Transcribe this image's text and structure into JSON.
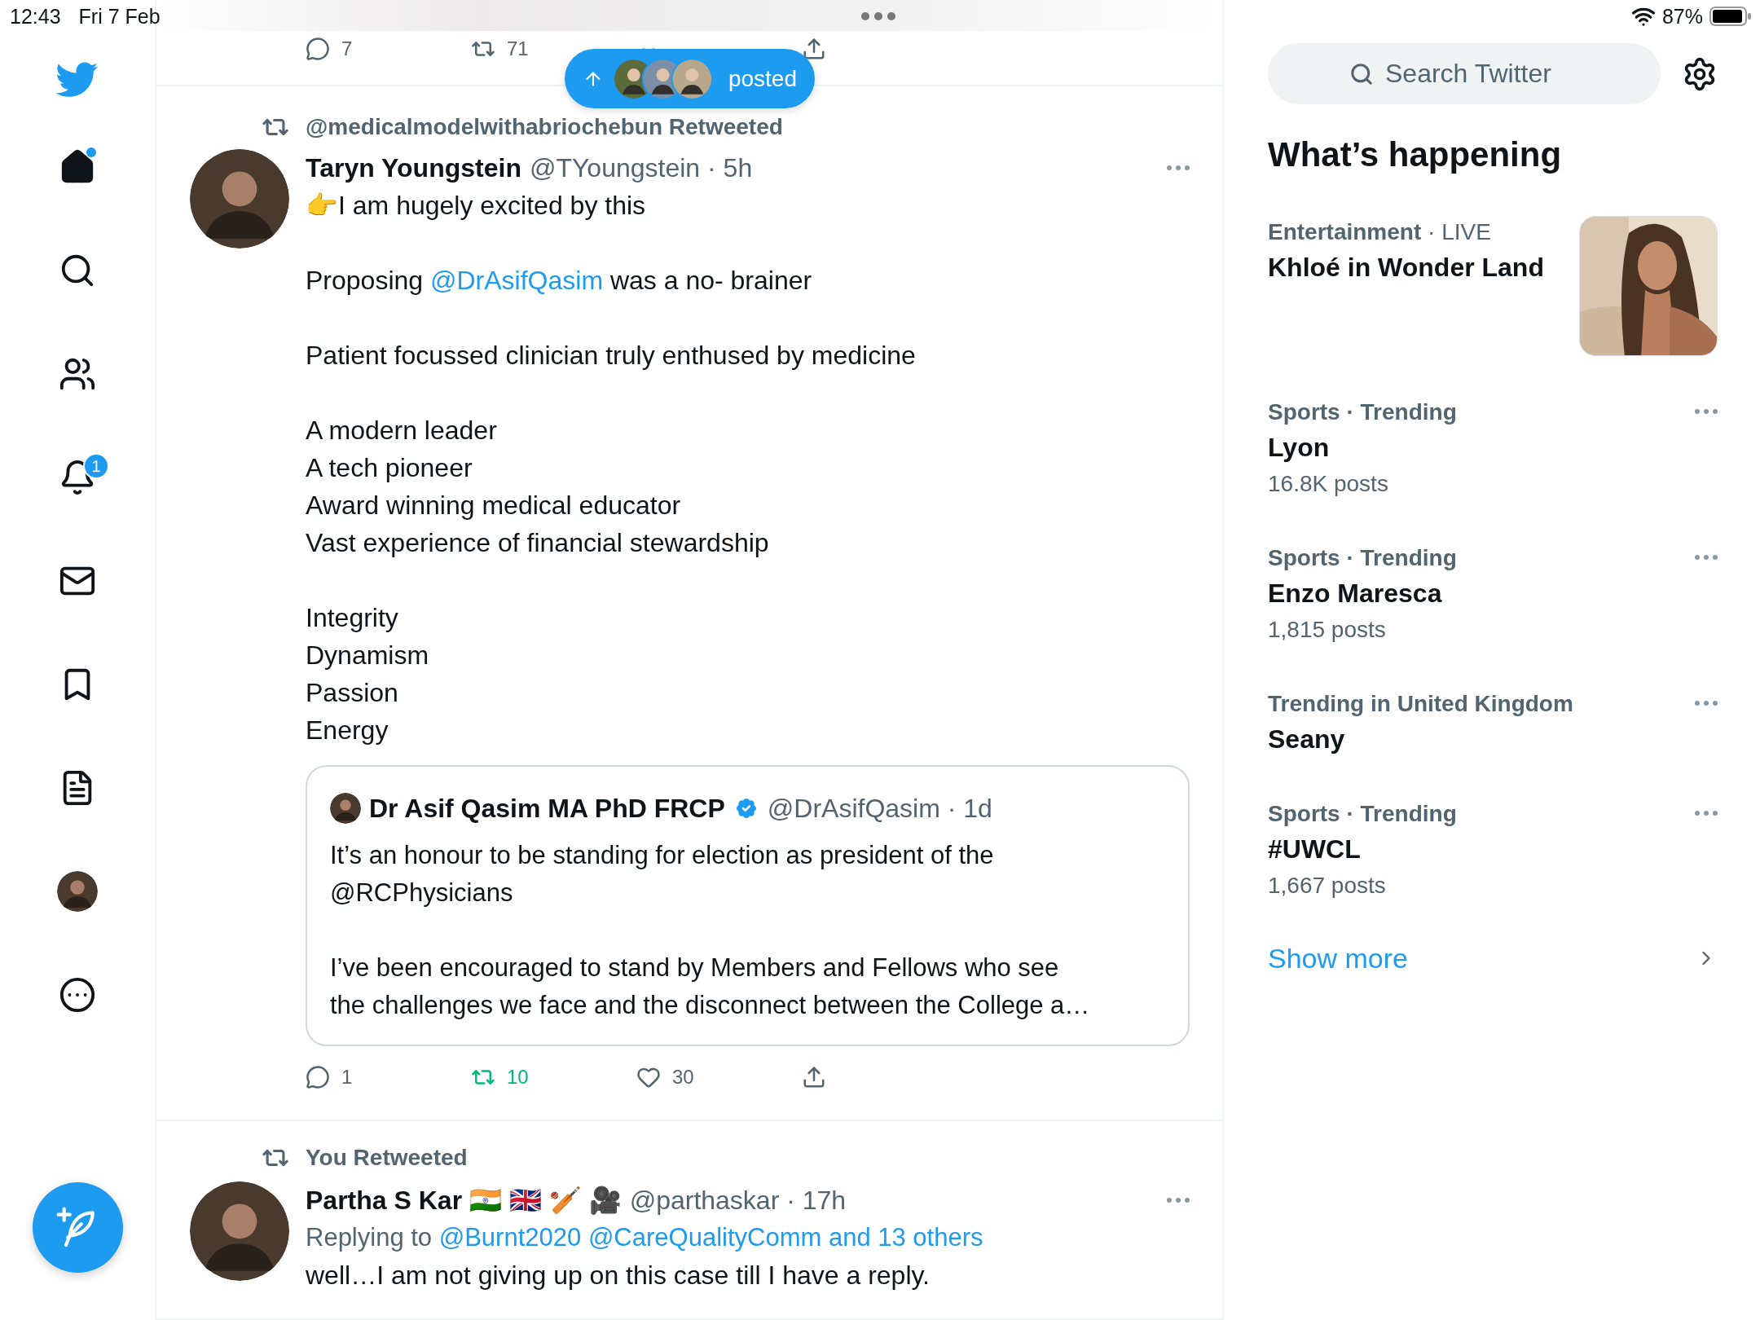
{
  "status_bar": {
    "time": "12:43",
    "date": "Fri 7 Feb",
    "battery": "87%"
  },
  "nav": [
    {
      "kind": "logo"
    },
    {
      "kind": "home",
      "unread": true
    },
    {
      "kind": "explore"
    },
    {
      "kind": "communities"
    },
    {
      "kind": "notifications",
      "badge": "1"
    },
    {
      "kind": "messages"
    },
    {
      "kind": "bookmarks"
    },
    {
      "kind": "lists"
    },
    {
      "kind": "profile"
    },
    {
      "kind": "more"
    }
  ],
  "new_posts": {
    "label": "posted"
  },
  "previous_tweet_actions": [
    {
      "kind": "reply",
      "count": "7",
      "active": false
    },
    {
      "kind": "retweet",
      "count": "71",
      "active": false
    },
    {
      "kind": "like",
      "active": false
    },
    {
      "kind": "share"
    }
  ],
  "tweets": [
    {
      "context": "@medicalmodelwithabriochebun Retweeted",
      "name": "Taryn Youngstein",
      "meta": "@TYoungstein · 5h",
      "paragraphs": [
        [
          "👉I am hugely excited by this"
        ],
        [
          {
            "segments": [
              {
                "text": "Proposing "
              },
              {
                "text": "@DrAsifQasim",
                "link": true
              },
              {
                "text": " was a no- brainer"
              }
            ]
          }
        ],
        [
          "Patient focussed clinician truly enthused by medicine"
        ],
        [
          "A modern leader",
          "A tech pioneer",
          "Award winning medical educator",
          "Vast experience of financial stewardship"
        ],
        [
          "Integrity",
          "Dynamism",
          "Passion",
          "Energy"
        ]
      ],
      "quote": {
        "name": "Dr Asif Qasim MA PhD FRCP",
        "verified": true,
        "meta": "@DrAsifQasim · 1d",
        "paragraphs": [
          [
            "It’s an honour to be standing for election as president of the",
            "@RCPhysicians"
          ],
          [
            "I’ve been encouraged to stand by Members and Fellows who see",
            "the challenges we face and the disconnect between the College a…"
          ]
        ]
      },
      "actions": [
        {
          "kind": "reply",
          "count": "1",
          "active": false
        },
        {
          "kind": "retweet",
          "count": "10",
          "active": true
        },
        {
          "kind": "like",
          "count": "30",
          "active": false
        },
        {
          "kind": "share"
        }
      ]
    },
    {
      "context": "You Retweeted",
      "name": "Partha S Kar 🇮🇳 🇬🇧 🏏 🎥",
      "meta": "@parthaskar · 17h",
      "replying": {
        "label": "Replying to",
        "links": [
          "@Burnt2020",
          "@CareQualityComm and 13 others"
        ]
      },
      "paragraphs": [
        [
          "well…I am not giving up on this case till I have a reply."
        ]
      ]
    }
  ],
  "sidebar": {
    "search": {
      "placeholder": "Search Twitter"
    },
    "heading": "What’s happening",
    "trends": [
      {
        "category": "Entertainment",
        "context": "· LIVE",
        "title": "Khloé in Wonder Land",
        "picture": true
      },
      {
        "category": "Sports · Trending",
        "title": "Lyon",
        "posts": "16.8K posts"
      },
      {
        "category": "Sports · Trending",
        "title": "Enzo Maresca",
        "posts": "1,815 posts"
      },
      {
        "category": "Trending in United Kingdom",
        "title": "Seany"
      },
      {
        "category": "Sports · Trending",
        "title": "#UWCL",
        "posts": "1,667 posts"
      }
    ],
    "show_more": "Show more"
  }
}
